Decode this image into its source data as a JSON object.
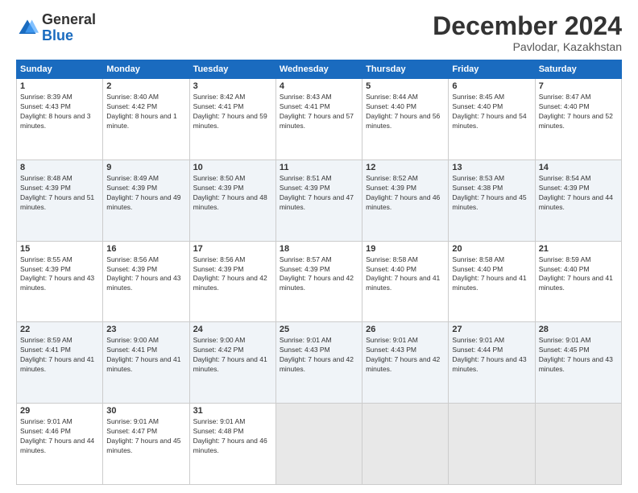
{
  "header": {
    "logo_general": "General",
    "logo_blue": "Blue",
    "title": "December 2024",
    "subtitle": "Pavlodar, Kazakhstan"
  },
  "calendar": {
    "days_of_week": [
      "Sunday",
      "Monday",
      "Tuesday",
      "Wednesday",
      "Thursday",
      "Friday",
      "Saturday"
    ],
    "weeks": [
      [
        {
          "day": "1",
          "sunrise": "8:39 AM",
          "sunset": "4:43 PM",
          "daylight": "8 hours and 3 minutes."
        },
        {
          "day": "2",
          "sunrise": "8:40 AM",
          "sunset": "4:42 PM",
          "daylight": "8 hours and 1 minute."
        },
        {
          "day": "3",
          "sunrise": "8:42 AM",
          "sunset": "4:41 PM",
          "daylight": "7 hours and 59 minutes."
        },
        {
          "day": "4",
          "sunrise": "8:43 AM",
          "sunset": "4:41 PM",
          "daylight": "7 hours and 57 minutes."
        },
        {
          "day": "5",
          "sunrise": "8:44 AM",
          "sunset": "4:40 PM",
          "daylight": "7 hours and 56 minutes."
        },
        {
          "day": "6",
          "sunrise": "8:45 AM",
          "sunset": "4:40 PM",
          "daylight": "7 hours and 54 minutes."
        },
        {
          "day": "7",
          "sunrise": "8:47 AM",
          "sunset": "4:40 PM",
          "daylight": "7 hours and 52 minutes."
        }
      ],
      [
        {
          "day": "8",
          "sunrise": "8:48 AM",
          "sunset": "4:39 PM",
          "daylight": "7 hours and 51 minutes."
        },
        {
          "day": "9",
          "sunrise": "8:49 AM",
          "sunset": "4:39 PM",
          "daylight": "7 hours and 49 minutes."
        },
        {
          "day": "10",
          "sunrise": "8:50 AM",
          "sunset": "4:39 PM",
          "daylight": "7 hours and 48 minutes."
        },
        {
          "day": "11",
          "sunrise": "8:51 AM",
          "sunset": "4:39 PM",
          "daylight": "7 hours and 47 minutes."
        },
        {
          "day": "12",
          "sunrise": "8:52 AM",
          "sunset": "4:39 PM",
          "daylight": "7 hours and 46 minutes."
        },
        {
          "day": "13",
          "sunrise": "8:53 AM",
          "sunset": "4:38 PM",
          "daylight": "7 hours and 45 minutes."
        },
        {
          "day": "14",
          "sunrise": "8:54 AM",
          "sunset": "4:39 PM",
          "daylight": "7 hours and 44 minutes."
        }
      ],
      [
        {
          "day": "15",
          "sunrise": "8:55 AM",
          "sunset": "4:39 PM",
          "daylight": "7 hours and 43 minutes."
        },
        {
          "day": "16",
          "sunrise": "8:56 AM",
          "sunset": "4:39 PM",
          "daylight": "7 hours and 43 minutes."
        },
        {
          "day": "17",
          "sunrise": "8:56 AM",
          "sunset": "4:39 PM",
          "daylight": "7 hours and 42 minutes."
        },
        {
          "day": "18",
          "sunrise": "8:57 AM",
          "sunset": "4:39 PM",
          "daylight": "7 hours and 42 minutes."
        },
        {
          "day": "19",
          "sunrise": "8:58 AM",
          "sunset": "4:40 PM",
          "daylight": "7 hours and 41 minutes."
        },
        {
          "day": "20",
          "sunrise": "8:58 AM",
          "sunset": "4:40 PM",
          "daylight": "7 hours and 41 minutes."
        },
        {
          "day": "21",
          "sunrise": "8:59 AM",
          "sunset": "4:40 PM",
          "daylight": "7 hours and 41 minutes."
        }
      ],
      [
        {
          "day": "22",
          "sunrise": "8:59 AM",
          "sunset": "4:41 PM",
          "daylight": "7 hours and 41 minutes."
        },
        {
          "day": "23",
          "sunrise": "9:00 AM",
          "sunset": "4:41 PM",
          "daylight": "7 hours and 41 minutes."
        },
        {
          "day": "24",
          "sunrise": "9:00 AM",
          "sunset": "4:42 PM",
          "daylight": "7 hours and 41 minutes."
        },
        {
          "day": "25",
          "sunrise": "9:01 AM",
          "sunset": "4:43 PM",
          "daylight": "7 hours and 42 minutes."
        },
        {
          "day": "26",
          "sunrise": "9:01 AM",
          "sunset": "4:43 PM",
          "daylight": "7 hours and 42 minutes."
        },
        {
          "day": "27",
          "sunrise": "9:01 AM",
          "sunset": "4:44 PM",
          "daylight": "7 hours and 43 minutes."
        },
        {
          "day": "28",
          "sunrise": "9:01 AM",
          "sunset": "4:45 PM",
          "daylight": "7 hours and 43 minutes."
        }
      ],
      [
        {
          "day": "29",
          "sunrise": "9:01 AM",
          "sunset": "4:46 PM",
          "daylight": "7 hours and 44 minutes."
        },
        {
          "day": "30",
          "sunrise": "9:01 AM",
          "sunset": "4:47 PM",
          "daylight": "7 hours and 45 minutes."
        },
        {
          "day": "31",
          "sunrise": "9:01 AM",
          "sunset": "4:48 PM",
          "daylight": "7 hours and 46 minutes."
        },
        null,
        null,
        null,
        null
      ]
    ]
  }
}
